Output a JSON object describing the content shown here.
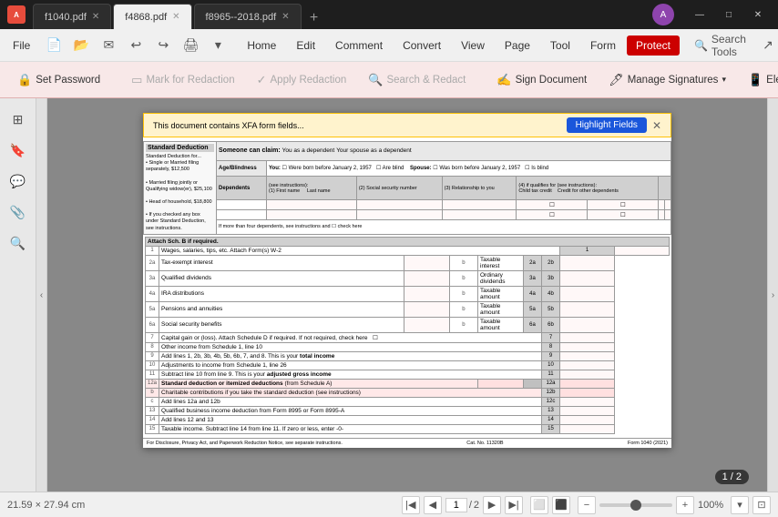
{
  "titlebar": {
    "app_icon": "A",
    "tabs": [
      {
        "id": "tab1",
        "label": "f1040.pdf",
        "active": false
      },
      {
        "id": "tab2",
        "label": "f4868.pdf",
        "active": true
      },
      {
        "id": "tab3",
        "label": "f8965--2018.pdf",
        "active": false
      }
    ],
    "add_tab": "+",
    "profile_initials": "A"
  },
  "menubar": {
    "file": "File",
    "home": "Home",
    "edit": "Edit",
    "comment": "Comment",
    "convert": "Convert",
    "view": "View",
    "page": "Page",
    "tool": "Tool",
    "form": "Form",
    "protect": "Protect",
    "search_tools": "Search Tools"
  },
  "toolbar": {
    "set_password": "Set Password",
    "mark_for_redaction": "Mark for Redaction",
    "apply_redaction": "Apply Redaction",
    "search_and_redact": "Search & Redact",
    "sign_document": "Sign Document",
    "manage_signatures": "Manage Signatures",
    "electronic": "Electro..."
  },
  "xfa_bar": {
    "message": "This document contains XFA form fields...",
    "button_label": "Highlight Fields"
  },
  "document": {
    "title": "Standard Deduction",
    "subtitle": "Someone can claim:",
    "page_label": "1 / 2"
  },
  "statusbar": {
    "dimensions": "21.59 × 27.94 cm",
    "page_current": "1",
    "page_total": "2",
    "page_display": "1 / 2",
    "zoom": "100%",
    "zoom_percent": "100%"
  },
  "sidebar": {
    "icons": [
      {
        "name": "pages-icon",
        "symbol": "⊞",
        "label": "Pages"
      },
      {
        "name": "bookmark-icon",
        "symbol": "🔖",
        "label": "Bookmark"
      },
      {
        "name": "comment-icon",
        "symbol": "💬",
        "label": "Comment"
      },
      {
        "name": "attachment-icon",
        "symbol": "📎",
        "label": "Attachment"
      },
      {
        "name": "search-icon",
        "symbol": "🔍",
        "label": "Search"
      }
    ]
  },
  "form": {
    "section_standard_deduction": "Standard Deduction",
    "section_for": "Standard Deduction for...",
    "bullet1": "• Single or Married filing separately, $12,500",
    "bullet2": "• Married filing jointly or Qualifying widow(er), $25,100",
    "bullet3": "• Head of household, $18,800",
    "bullet4": "• If you checked any box under Standard Deduction, see instructions.",
    "dependents_header": "Dependents",
    "dependents_col1": "(1) First name     Last name",
    "dependents_col2": "(2) Social security number",
    "dependents_col3": "(3) Relationship to you",
    "dependents_col4": "(4) if qualifies for (see instructions):",
    "dependents_col4a": "Child tax credit",
    "dependents_col4b": "Credit for other dependents",
    "you_label": "You:",
    "spouse_label": "Spouse:",
    "born_before": "Were born before January 2, 1957",
    "are_blind": "Are blind",
    "spouse_born": "Was born before January 2, 1957",
    "is_blind": "Is blind",
    "age_blindness": "Age/Blindness",
    "attach_label": "Attach Sch. B if required.",
    "lines": [
      {
        "num": "1",
        "label": "Wages, salaries, tips, etc. Attach Form(s) W-2",
        "right_num": "1"
      },
      {
        "num": "2a",
        "label": "Tax-exempt interest",
        "b_label": "b",
        "b_text": "Taxable interest",
        "right_a": "2a",
        "right_b": "2b"
      },
      {
        "num": "3a",
        "label": "Qualified dividends",
        "b_label": "b",
        "b_text": "Ordinary dividends",
        "right_a": "3a",
        "right_b": "3b"
      },
      {
        "num": "4a",
        "label": "IRA distributions",
        "b_label": "b",
        "b_text": "Taxable amount",
        "right_a": "4a",
        "right_b": "4b"
      },
      {
        "num": "5a",
        "label": "Pensions and annuities",
        "b_label": "b",
        "b_text": "Taxable amount",
        "right_a": "5a",
        "right_b": "5b"
      },
      {
        "num": "6a",
        "label": "Social security benefits",
        "b_label": "b",
        "b_text": "Taxable amount",
        "right_a": "6a",
        "right_b": "6b"
      },
      {
        "num": "7",
        "label": "Capital gain or (loss). Attach Schedule D if required. If not required, check here",
        "right_num": "7"
      },
      {
        "num": "8",
        "label": "Other income from Schedule 1, line 10",
        "right_num": "8"
      },
      {
        "num": "9",
        "label": "Add lines 1, 2b, 3b, 4b, 5b, 6b, 7, and 8. This is your total income",
        "right_num": "9"
      },
      {
        "num": "10",
        "label": "Adjustments to income from Schedule 1, line 26",
        "right_num": "10"
      },
      {
        "num": "11",
        "label": "Subtract line 10 from line 9. This is your adjusted gross income",
        "right_num": "11"
      },
      {
        "num": "12a",
        "label": "Standard deduction or itemized deductions (from Schedule A)",
        "right_num": "12a",
        "highlight": true
      },
      {
        "num": "b",
        "label": "Charitable contributions if you take the standard deduction (see instructions)",
        "right_num": "12b",
        "highlight": true
      },
      {
        "num": "c",
        "label": "Add lines 12a and 12b",
        "right_num": "12c"
      },
      {
        "num": "13",
        "label": "Qualified business income deduction from Form 8995 or Form 8995-A",
        "right_num": "13"
      },
      {
        "num": "14",
        "label": "Add lines 12 and 13",
        "right_num": "14"
      },
      {
        "num": "15",
        "label": "Taxable income. Subtract line 14 from line 11. If zero or less, enter -0-",
        "right_num": "15"
      }
    ],
    "footer_left": "For Disclosure, Privacy Act, and Paperwork Reduction Notice, see separate instructions.",
    "footer_cat": "Cat. No. 11320B",
    "footer_form": "Form 1040 (2021)"
  }
}
